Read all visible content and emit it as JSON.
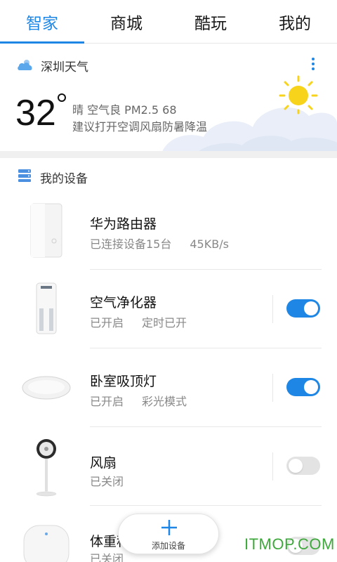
{
  "tabs": [
    {
      "label": "智家",
      "active": true
    },
    {
      "label": "商城",
      "active": false
    },
    {
      "label": "酷玩",
      "active": false
    },
    {
      "label": "我的",
      "active": false
    }
  ],
  "weather": {
    "city_label": "深圳天气",
    "temperature": "32",
    "line1": "晴 空气良 PM2.5 68",
    "line2": "建议打开空调风扇防暑降温",
    "icons": [
      "cloud-icon",
      "sun-icon",
      "more-vertical-icon"
    ]
  },
  "devices_section": {
    "title": "我的设备",
    "icon": "device-list-icon"
  },
  "devices": [
    {
      "name": "华为路由器",
      "status1": "已连接设备15台",
      "status2": "45KB/s",
      "toggle": null
    },
    {
      "name": "空气净化器",
      "status1": "已开启",
      "status2": "定时已开",
      "toggle": true
    },
    {
      "name": "卧室吸顶灯",
      "status1": "已开启",
      "status2": "彩光模式",
      "toggle": true
    },
    {
      "name": "风扇",
      "status1": "已关闭",
      "status2": "",
      "toggle": false
    },
    {
      "name": "体重秤",
      "status1": "已关闭",
      "status2": "",
      "toggle": false
    }
  ],
  "fab": {
    "label": "添加设备",
    "icon": "plus-icon"
  },
  "watermark": "ITMOP.COM",
  "colors": {
    "accent": "#1e87e6",
    "toggle_off": "#e3e3e3",
    "watermark": "#3fa83c"
  }
}
